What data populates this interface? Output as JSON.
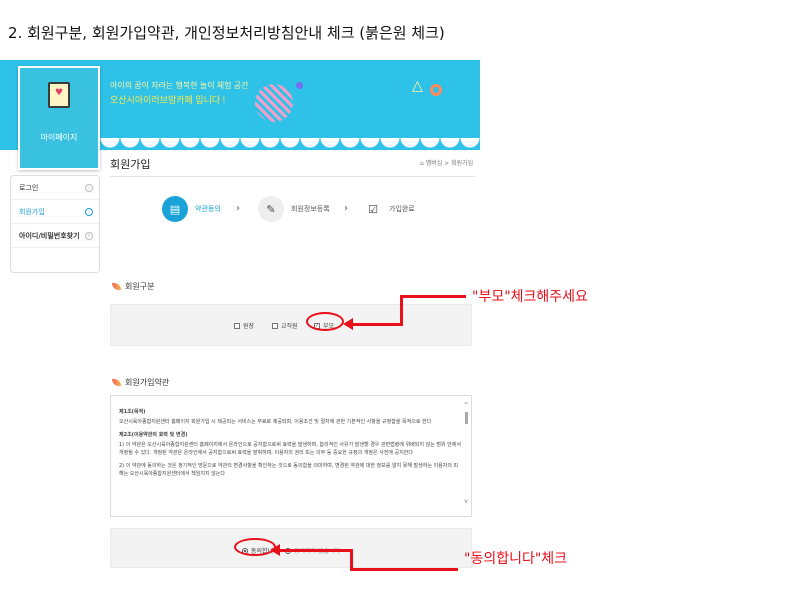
{
  "caption": "2. 회원구분, 회원가입약관, 개인정보처리방침안내 체크 (붉은원 체크)",
  "banner": {
    "line1": "아이의 꿈이 자라는 행복한 놀이 체험 공간",
    "line2": "오산시아이러브맘카페 입니다 !"
  },
  "sidebar": {
    "title": "마이페이지",
    "items": [
      {
        "label": "로그인"
      },
      {
        "label": "회원가입"
      },
      {
        "label": "아이디/비밀번호찾기"
      }
    ]
  },
  "page": {
    "title": "회원가입",
    "breadcrumb": "멤버십 > 회원가입"
  },
  "steps": [
    {
      "label": "약관동의",
      "icon": "document-icon"
    },
    {
      "label": "회원정보등록",
      "icon": "pencil-icon"
    },
    {
      "label": "가입완료",
      "icon": "checkbox-icon"
    }
  ],
  "member_type": {
    "title": "회원구분",
    "options": [
      {
        "label": "원장",
        "checked": false
      },
      {
        "label": "교직원",
        "checked": false
      },
      {
        "label": "부모",
        "checked": true
      }
    ]
  },
  "terms": {
    "title": "회원가입약관",
    "h1": "제1조(목적)",
    "p1": "오산시육아종합지원센터 홈페이지 회원가입 시 제공되는 서비스는 무료로 제공되며, 이용조건 및 절차에 관한 기본적인 사항을 규정함을 목적으로 한다",
    "h2": "제2조(이용약관의 효력 및 변경)",
    "p2": "1) 이 약관은 오산시육아종합지원센터 홈페이지에서 온라인으로 공지함으로써 효력을 발생하며, 합리적인 사유가 발생할 경우 관련법령에 위배되지 않는 범위 안에서 개정될 수 있다. 개정된 약관은 온라인에서 공지함으로써 효력을 발휘하며, 이용자의 권리 또는 의무 등 중요한 규정의 개정은 사전에 공지한다",
    "p3": "2) 이 약관에 동의하는 것은 정기적인 방문으로 약관의 변경사항을 확인하는 것으로 동의함을 의미하며, 변경된 약관에 대한 정보를 알지 못해 발생하는 이용자의 피해는 오산시육아종합지원센터에서 책임지지 않는다"
  },
  "agree": {
    "yes": "동의합니다",
    "no": "동의하지 않습니다"
  },
  "annotations": {
    "parent_note": "\"부모\"체크해주세요",
    "agree_note": "\"동의합니다\"체크",
    "color": "#e8101a"
  }
}
